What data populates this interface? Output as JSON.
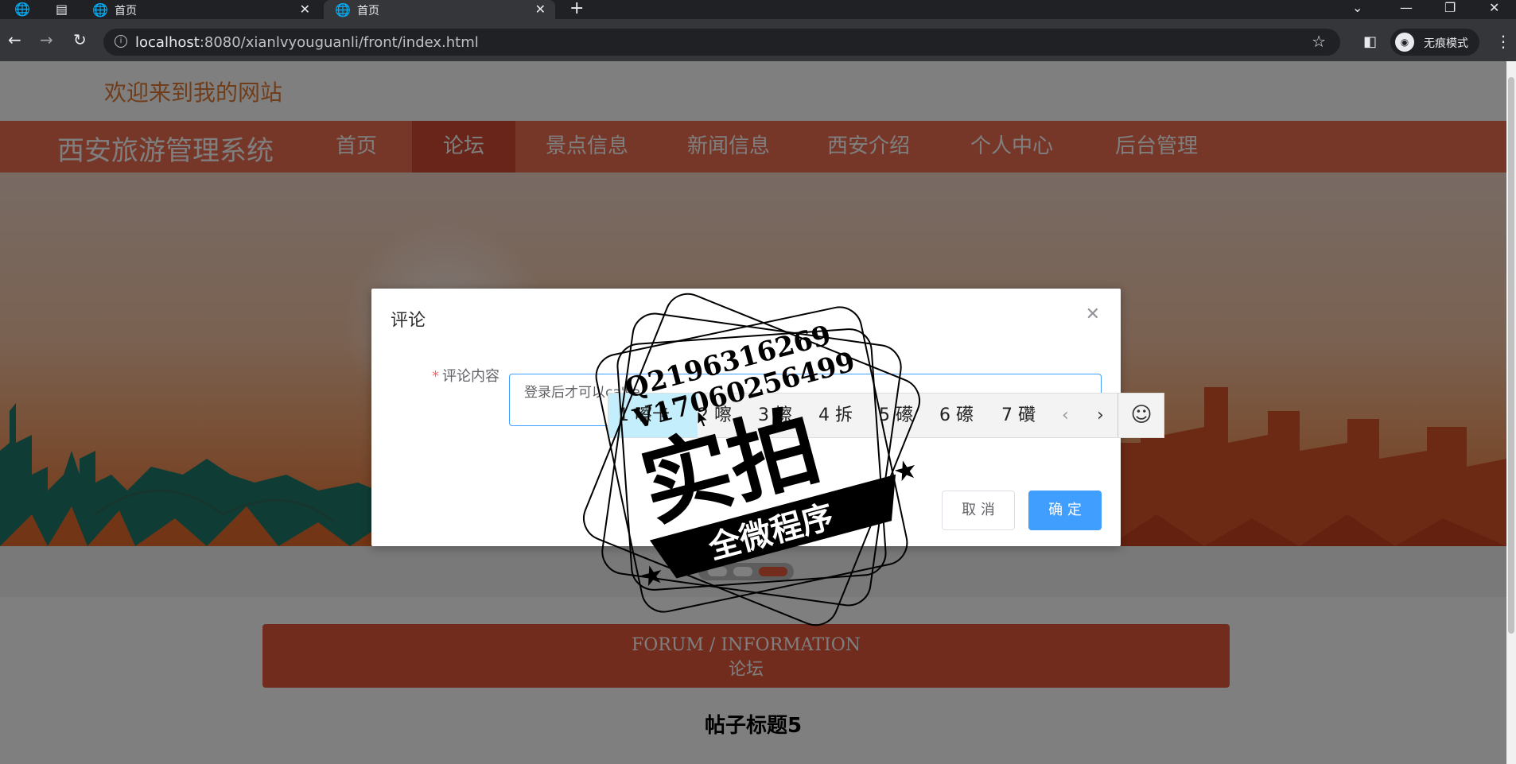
{
  "browser": {
    "tabs": [
      {
        "title": "首页",
        "active": false
      },
      {
        "title": "首页",
        "active": true
      }
    ],
    "url_host": "localhost",
    "url_path": ":8080/xianlvyouguanli/front/index.html",
    "incognito_label": "无痕模式"
  },
  "page": {
    "welcome": "欢迎来到我的网站",
    "site_title": "西安旅游管理系统",
    "nav": [
      {
        "label": "首页",
        "active": false
      },
      {
        "label": "论坛",
        "active": true
      },
      {
        "label": "景点信息",
        "active": false
      },
      {
        "label": "新闻信息",
        "active": false
      },
      {
        "label": "西安介绍",
        "active": false
      },
      {
        "label": "个人中心",
        "active": false
      },
      {
        "label": "后台管理",
        "active": false
      }
    ],
    "carousel": {
      "count": 3,
      "active_index": 2
    },
    "forum_en": "FORUM / INFORMATION",
    "forum_cn": "论坛",
    "post_title": "帖子标题5"
  },
  "dialog": {
    "title": "评论",
    "field_label": "评论内容",
    "required_mark": "*",
    "content_value": "登录后才可以ca'ka",
    "cancel_label": "取 消",
    "confirm_label": "确 定"
  },
  "ime": {
    "candidates": [
      {
        "index": "1",
        "text": "嚓卡"
      },
      {
        "index": "2",
        "text": "嚓"
      },
      {
        "index": "3",
        "text": "擦"
      },
      {
        "index": "4",
        "text": "拆"
      },
      {
        "index": "5",
        "text": "礤"
      },
      {
        "index": "6",
        "text": "礤"
      },
      {
        "index": "7",
        "text": "礸"
      }
    ],
    "prev": "‹",
    "next": "›",
    "emoji": "☺"
  },
  "stamp": {
    "line1": "Q2196316269",
    "line2": "V17060256499",
    "big": "实拍",
    "banner": "全微程序"
  },
  "colors": {
    "accent": "#ee6f50",
    "nav_active": "#d24b33",
    "primary_button": "#409eff",
    "welcome_text": "#e07a36",
    "forum_box": "#e4583c"
  }
}
